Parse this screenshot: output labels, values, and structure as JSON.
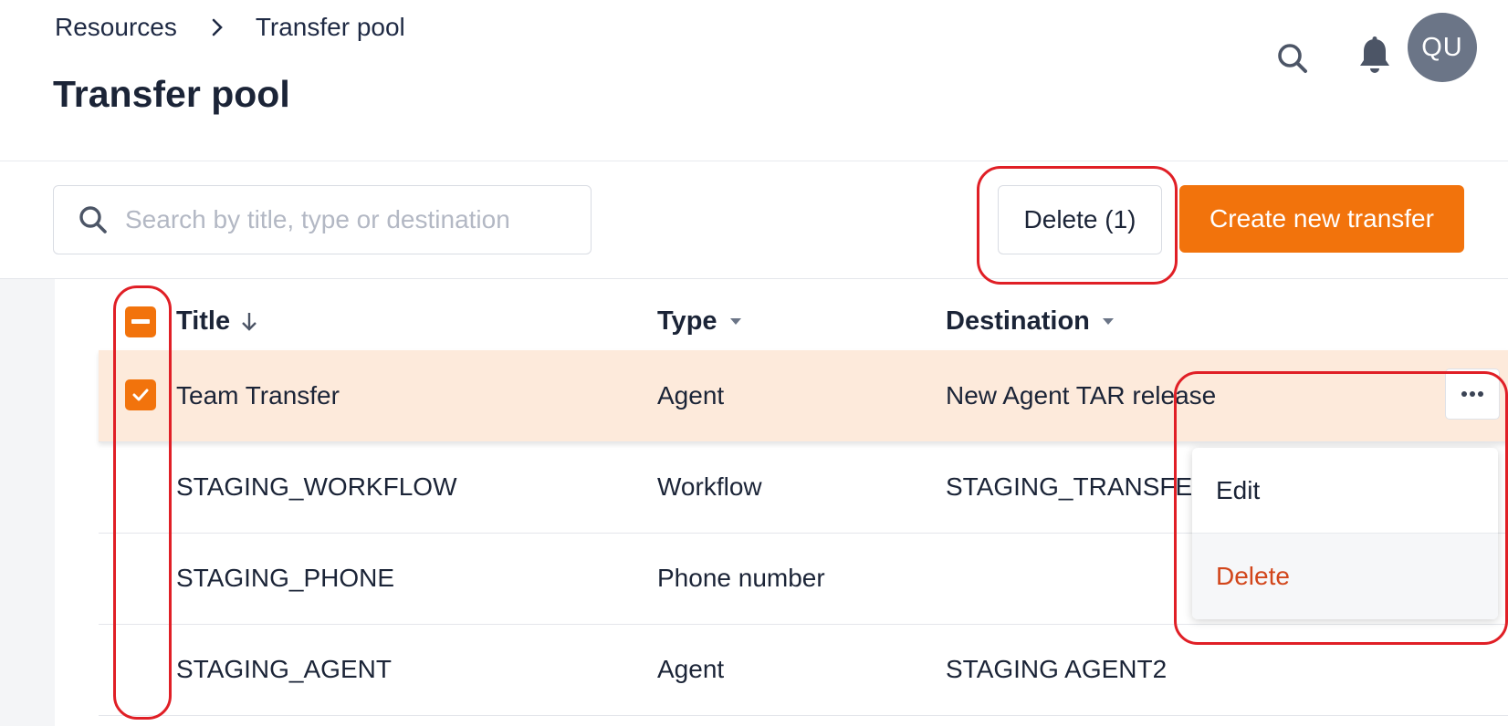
{
  "breadcrumb": {
    "parent": "Resources",
    "current": "Transfer pool"
  },
  "page": {
    "title": "Transfer pool"
  },
  "header": {
    "avatar_initials": "QU"
  },
  "toolbar": {
    "search_placeholder": "Search by title, type or destination",
    "delete_bulk_label": "Delete (1)",
    "create_label": "Create new transfer"
  },
  "table": {
    "columns": {
      "title": "Title",
      "type": "Type",
      "destination": "Destination"
    },
    "rows": [
      {
        "title": "Team Transfer",
        "type": "Agent",
        "destination": "New Agent TAR release",
        "checked": true
      },
      {
        "title": "STAGING_WORKFLOW",
        "type": "Workflow",
        "destination": "STAGING_TRANSFER",
        "checked": false
      },
      {
        "title": "STAGING_PHONE",
        "type": "Phone number",
        "destination": "",
        "checked": false
      },
      {
        "title": "STAGING_AGENT",
        "type": "Agent",
        "destination": "STAGING AGENT2",
        "checked": false
      }
    ]
  },
  "row_menu": {
    "edit_label": "Edit",
    "delete_label": "Delete"
  },
  "colors": {
    "accent": "#f2730c",
    "selected_row": "#fdeadb",
    "danger": "#d2461b",
    "annotation": "#e01f26"
  },
  "icons": [
    "chevron-right-icon",
    "search-icon",
    "bell-icon",
    "sort-arrow-down-icon",
    "caret-down-icon",
    "checkbox-indeterminate-icon",
    "checkbox-checked-icon",
    "ellipsis-icon"
  ]
}
